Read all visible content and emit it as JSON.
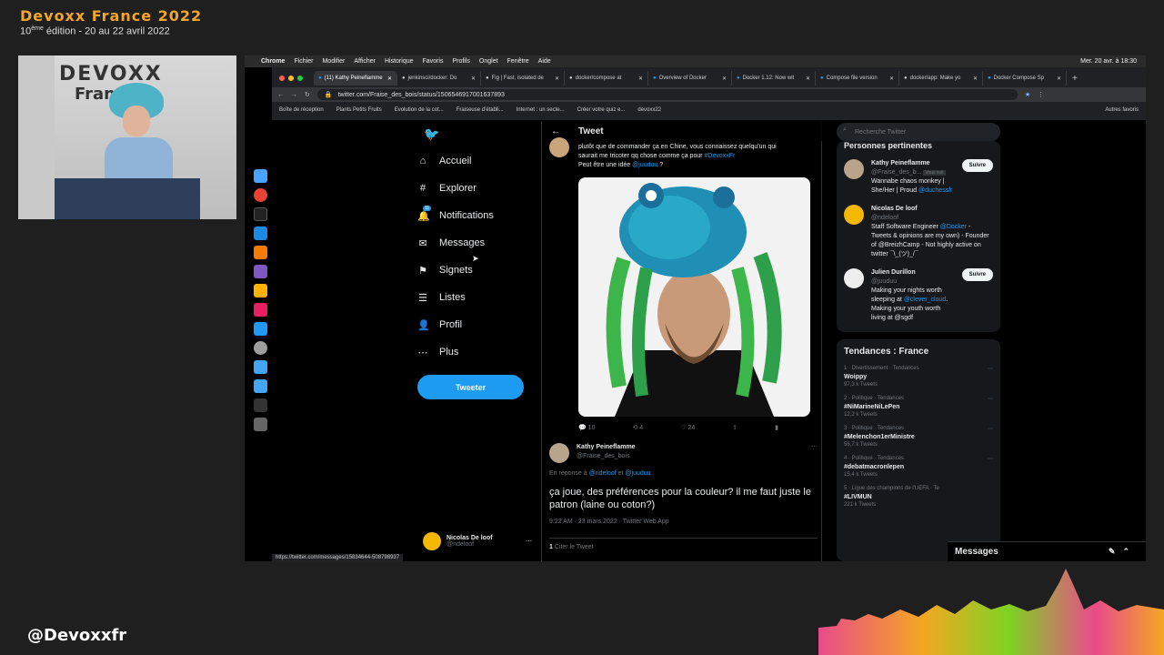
{
  "conference": {
    "title": "Devoxx France 2022",
    "edition_num": "10",
    "edition_sup": "ème",
    "edition_rest": " édition - 20 au 22 avril 2022",
    "handle": "@Devoxxfr"
  },
  "speaker": {
    "logo_top": "DEVOXX",
    "logo_bottom": "France"
  },
  "macbar": {
    "apple": "",
    "items": [
      "Chrome",
      "Fichier",
      "Modifier",
      "Afficher",
      "Historique",
      "Favoris",
      "Profils",
      "Onglet",
      "Fenêtre",
      "Aide"
    ],
    "datetime": "Mer. 20 avr. à 18:30"
  },
  "tabs": [
    {
      "label": "(11) Kathy Peineflamme",
      "active": true
    },
    {
      "label": "jenkinsci/docker: Do"
    },
    {
      "label": "Fig | Fast, isolated de"
    },
    {
      "label": "docker/compose at"
    },
    {
      "label": "Overview of Docker"
    },
    {
      "label": "Docker 1.12: Now wit"
    },
    {
      "label": "Compose file version"
    },
    {
      "label": "docker/app: Make yo"
    },
    {
      "label": "Docker Compose Sp"
    }
  ],
  "address": {
    "url": "twitter.com/Fraise_des_bois/status/1506546917001637893"
  },
  "bookmarks": {
    "items": [
      "Boîte de réception",
      "Plants Petits Fruits",
      "Evolution de la cot...",
      "Fraiseuse d'établi...",
      "Internet : un secte...",
      "Créer votre quiz e...",
      "devoxx22"
    ],
    "right": "Autres favoris"
  },
  "twitter": {
    "nav": [
      "Accueil",
      "Explorer",
      "Notifications",
      "Messages",
      "Signets",
      "Listes",
      "Profil",
      "Plus"
    ],
    "notif_badge": "11",
    "tweet_button": "Tweeter",
    "account": {
      "name": "Nicolas De loof",
      "handle": "@ndeloof"
    },
    "center_title": "Tweet",
    "tweet": {
      "line1": "plutôt que de commander ça en Chine, vous connaissez quelqu'un qui",
      "line2a": "saurait me tricoter qq chose comme ça pour ",
      "line2_tag": "#DevoxxFr",
      "line3a": "Peut être une idée ",
      "line3_mention": "@juuduu",
      "line3b": " ?"
    },
    "actions": {
      "replies": "10",
      "retweets": "4",
      "likes": "24"
    },
    "reply": {
      "name": "Kathy Peineflamme",
      "handle": "@Fraise_des_bois",
      "in_reply_prefix": "En réponse à ",
      "in_reply_to1": "@ndeloof",
      "in_reply_and": " et ",
      "in_reply_to2": "@juuduu",
      "text": "ça joue, des préférences pour la couleur? il me faut juste le patron (laine ou coton?)",
      "meta": "9:22 AM · 23 mars 2022 · Twitter Web App",
      "quote_count": "1",
      "quote_label": " Citer le Tweet"
    },
    "search_placeholder": "Recherche Twitter",
    "people": {
      "title": "Personnes pertinentes",
      "list": [
        {
          "name": "Kathy Peineflamme",
          "handle": "@Fraise_des_b...",
          "follows_you": "Vous suit",
          "bio_a": "Wannabe chaos monkey | She/Her | Proud ",
          "bio_link": "@duchessfr",
          "bio_b": "",
          "follow": "Suivre"
        },
        {
          "name": "Nicolas De loof",
          "handle": "@ndeloof",
          "follows_you": "",
          "bio_a": "Staff Software Engineer ",
          "bio_link": "@Docker",
          "bio_b": " - Tweets & opinions are my own) - Founder of @BreizhCamp - Not highly active on twitter ¯\\_(ツ)_/¯",
          "follow": ""
        },
        {
          "name": "Julien Durillon",
          "handle": "@juuduu",
          "follows_you": "",
          "bio_a": "Making your nights worth sleeping at ",
          "bio_link": "@clever_cloud",
          "bio_b": ". Making your youth worth living at @sgdf",
          "follow": "Suivre"
        }
      ]
    },
    "trends": {
      "title": "Tendances : France",
      "list": [
        {
          "meta": "1 · Divertissement · Tendances",
          "tag": "Woippy",
          "count": "97,3 k Tweets"
        },
        {
          "meta": "2 · Politique · Tendances",
          "tag": "#NiMarineNiLePen",
          "count": "12,2 k Tweets"
        },
        {
          "meta": "3 · Politique · Tendances",
          "tag": "#Melenchon1erMinistre",
          "count": "56,7 k Tweets"
        },
        {
          "meta": "4 · Politique · Tendances",
          "tag": "#debatmacronlepen",
          "count": "15,4 k Tweets"
        },
        {
          "meta": "5 · Ligue des champions de l'UEFA · Te",
          "tag": "#LIVMUN",
          "count": "221 k Tweets"
        }
      ]
    },
    "messages_drawer": "Messages",
    "status_url": "https://twitter.com/messages/15834644-508798937"
  },
  "colors": {
    "accent": "#1d9bf0",
    "conference": "#f5a623"
  }
}
